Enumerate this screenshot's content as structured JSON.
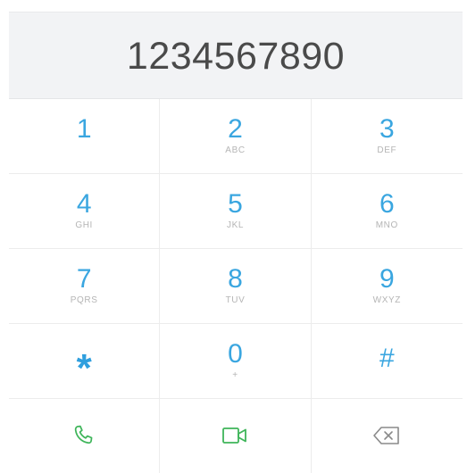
{
  "display": {
    "number": "1234567890"
  },
  "keys": [
    {
      "digit": "1",
      "letters": ""
    },
    {
      "digit": "2",
      "letters": "ABC"
    },
    {
      "digit": "3",
      "letters": "DEF"
    },
    {
      "digit": "4",
      "letters": "GHI"
    },
    {
      "digit": "5",
      "letters": "JKL"
    },
    {
      "digit": "6",
      "letters": "MNO"
    },
    {
      "digit": "7",
      "letters": "PQRS"
    },
    {
      "digit": "8",
      "letters": "TUV"
    },
    {
      "digit": "9",
      "letters": "WXYZ"
    },
    {
      "digit": "*",
      "letters": ""
    },
    {
      "digit": "0",
      "letters": "+"
    },
    {
      "digit": "#",
      "letters": ""
    }
  ],
  "actions": {
    "call_icon": "phone-icon",
    "video_icon": "video-camera-icon",
    "backspace_icon": "backspace-icon"
  },
  "colors": {
    "digit": "#3aa6e0",
    "letters": "#b5b5b5",
    "call": "#3fb55a",
    "video": "#3fb55a",
    "backspace": "#8a8a8a",
    "display_bg": "#f2f3f5"
  }
}
